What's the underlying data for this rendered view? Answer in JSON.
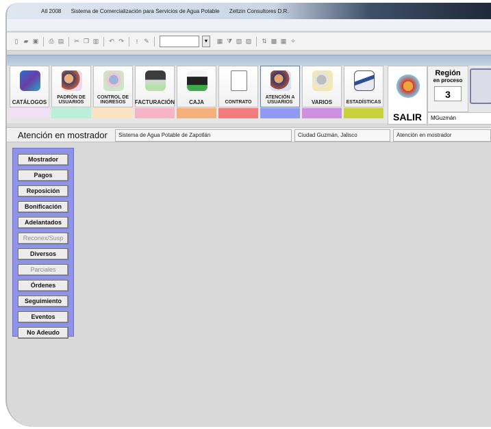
{
  "title_bar": {
    "app": "Atl 2008",
    "system": "Sistema de Comercialización para Servicios de Agua Potable",
    "company": "Zeltzin Consultores D.R."
  },
  "modules": [
    {
      "label": "CATÁLOGOS",
      "icon": "books-icon",
      "strip_color": "#f0dff5"
    },
    {
      "label": "PADRÓN DE USUARIOS",
      "icon": "users-icon",
      "strip_color": "#b9f0d8"
    },
    {
      "label": "CONTROL DE INGRESOS",
      "icon": "income-icon",
      "strip_color": "#fbe3c0"
    },
    {
      "label": "FACTURACIÓN",
      "icon": "printer-icon",
      "strip_color": "#f7b3c8"
    },
    {
      "label": "CAJA",
      "icon": "cash-register-icon",
      "strip_color": "#f6b07b"
    },
    {
      "label": "CONTRATO",
      "icon": "document-icon",
      "strip_color": "#f47b7b"
    },
    {
      "label": "ATENCIÓN A USUARIOS",
      "icon": "service-icon",
      "strip_color": "#9199f2"
    },
    {
      "label": "VARIOS",
      "icon": "gears-icon",
      "strip_color": "#cf8fe0"
    },
    {
      "label": "ESTADÍSTICAS",
      "icon": "chart-icon",
      "strip_color": "#c9d13a"
    }
  ],
  "salir": {
    "label": "SALIR",
    "icon": "house-exit-icon"
  },
  "region": {
    "title": "Región",
    "subtitle": "en proceso",
    "value": "3"
  },
  "user": "MGuzmán",
  "status": {
    "section": "Atención en mostrador",
    "organization": "Sistema de Agua Potable de Zapotlán",
    "city": "Ciudad Guzmán, Jalisco",
    "mode": "Atención en mostrador"
  },
  "side_menu": [
    {
      "label": "Mostrador",
      "enabled": true
    },
    {
      "label": "Pagos",
      "enabled": true
    },
    {
      "label": "Reposición",
      "enabled": true
    },
    {
      "label": "Bonificación",
      "enabled": true
    },
    {
      "label": "Adelantados",
      "enabled": true
    },
    {
      "label": "Reconex/Susp",
      "enabled": false
    },
    {
      "label": "Diversos",
      "enabled": true
    },
    {
      "label": "Parciales",
      "enabled": false
    },
    {
      "label": "Órdenes",
      "enabled": true
    },
    {
      "label": "Seguimiento",
      "enabled": true
    },
    {
      "label": "Eventos",
      "enabled": true
    },
    {
      "label": "No Adeudo",
      "enabled": true
    }
  ]
}
